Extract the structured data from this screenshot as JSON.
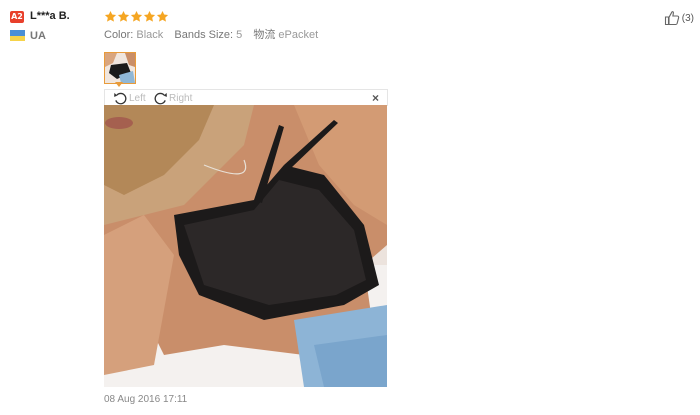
{
  "reviewer": {
    "level_badge": "A2",
    "name": "L***a B.",
    "country": "UA"
  },
  "review": {
    "stars": 5,
    "attributes": [
      {
        "label": "Color:",
        "value": "Black"
      },
      {
        "label": "Bands Size:",
        "value": "5"
      },
      {
        "label": "物流",
        "value": "ePacket"
      }
    ],
    "helpful_count": "(3)",
    "date": "08 Aug 2016 17:11"
  },
  "viewer": {
    "rotate_left_label": "Left",
    "rotate_right_label": "Right",
    "close_label": "×"
  },
  "colors": {
    "star": "#f5a623",
    "accent_border": "#e89b3a",
    "badge": "#e8402b"
  }
}
